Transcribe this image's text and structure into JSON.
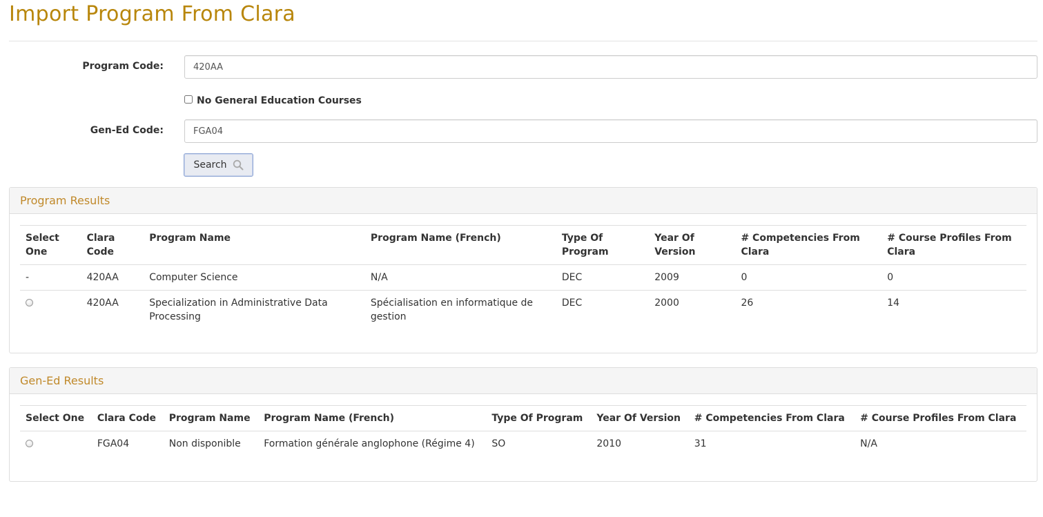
{
  "page": {
    "title": "Import Program From Clara"
  },
  "form": {
    "program_code_label": "Program Code:",
    "program_code_value": "420AA",
    "no_gen_ed_label": "No General Education Courses",
    "no_gen_ed_checked": false,
    "gen_ed_code_label": "Gen-Ed Code:",
    "gen_ed_code_value": "FGA04",
    "search_label": "Search",
    "search_icon": "search-icon"
  },
  "program_results": {
    "heading": "Program Results",
    "columns": {
      "select": "Select One",
      "code": "Clara Code",
      "name": "Program Name",
      "name_fr": "Program Name (French)",
      "type": "Type Of Program",
      "year": "Year Of Version",
      "competencies": "# Competencies From Clara",
      "profiles": "# Course Profiles From Clara"
    },
    "rows": [
      {
        "select": "-",
        "code": "420AA",
        "name": "Computer Science",
        "name_fr": "N/A",
        "type": "DEC",
        "year": "2009",
        "competencies": "0",
        "profiles": "0"
      },
      {
        "select": "",
        "code": "420AA",
        "name": "Specialization in Administrative Data Processing",
        "name_fr": "Spécialisation en informatique de gestion",
        "type": "DEC",
        "year": "2000",
        "competencies": "26",
        "profiles": "14"
      }
    ]
  },
  "gen_ed_results": {
    "heading": "Gen-Ed Results",
    "columns": {
      "select": "Select One",
      "code": "Clara Code",
      "name": "Program Name",
      "name_fr": "Program Name (French)",
      "type": "Type Of Program",
      "year": "Year Of Version",
      "competencies": "# Competencies From Clara",
      "profiles": "# Course Profiles From Clara"
    },
    "rows": [
      {
        "select": "",
        "code": "FGA04",
        "name": "Non disponible",
        "name_fr": "Formation générale anglophone (Régime 4)",
        "type": "SO",
        "year": "2010",
        "competencies": "31",
        "profiles": "N/A"
      }
    ]
  },
  "colors": {
    "title": "#b8860b",
    "panel_heading": "#c0892a",
    "border": "#dddddd",
    "panel_bg": "#f5f5f5"
  }
}
